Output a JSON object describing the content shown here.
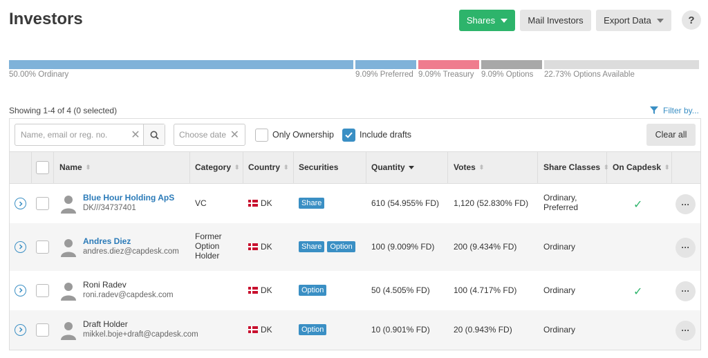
{
  "header": {
    "title": "Investors",
    "shares_btn": "Shares",
    "mail_btn": "Mail Investors",
    "export_btn": "Export Data",
    "help": "?"
  },
  "distribution": [
    {
      "label": "50.00% Ordinary",
      "share": 0.5,
      "color": "#7fb2d9"
    },
    {
      "label": "9.09% Preferred",
      "share": 0.0909,
      "color": "#7fb2d9"
    },
    {
      "label": "9.09% Treasury",
      "share": 0.0909,
      "color": "#ef7c8e"
    },
    {
      "label": "9.09% Options",
      "share": 0.0909,
      "color": "#a8a8a8"
    },
    {
      "label": "22.73% Options Available",
      "share": 0.2273,
      "color": "#dcdcdc"
    }
  ],
  "showing": "Showing 1-4 of 4 (0 selected)",
  "filter_by": "Filter by...",
  "filters": {
    "search_placeholder": "Name, email or reg. no.",
    "date_placeholder": "Choose date",
    "only_ownership": "Only Ownership",
    "include_drafts": "Include drafts",
    "clear_all": "Clear all"
  },
  "columns": {
    "name": "Name",
    "category": "Category",
    "country": "Country",
    "securities": "Securities",
    "quantity": "Quantity",
    "votes": "Votes",
    "share_classes": "Share Classes",
    "on_capdesk": "On Capdesk"
  },
  "rows": [
    {
      "name": "Blue Hour Holding ApS",
      "sub": "DK///34737401",
      "category": "VC",
      "country": "DK",
      "securities": [
        "Share"
      ],
      "quantity": "610 (54.955% FD)",
      "votes": "1,120 (52.830% FD)",
      "classes": "Ordinary, Preferred",
      "on_capdesk": true,
      "link": true
    },
    {
      "name": "Andres Diez",
      "sub": "andres.diez@capdesk.com",
      "category": "Former Option Holder",
      "country": "DK",
      "securities": [
        "Share",
        "Option"
      ],
      "quantity": "100 (9.009% FD)",
      "votes": "200 (9.434% FD)",
      "classes": "Ordinary",
      "on_capdesk": false,
      "link": true
    },
    {
      "name": "Roni Radev",
      "sub": "roni.radev@capdesk.com",
      "category": "",
      "country": "DK",
      "securities": [
        "Option"
      ],
      "quantity": "50 (4.505% FD)",
      "votes": "100 (4.717% FD)",
      "classes": "Ordinary",
      "on_capdesk": true,
      "link": false
    },
    {
      "name": "Draft Holder",
      "sub": "mikkel.boje+draft@capdesk.com",
      "category": "",
      "country": "DK",
      "securities": [
        "Option"
      ],
      "quantity": "10 (0.901% FD)",
      "votes": "20 (0.943% FD)",
      "classes": "Ordinary",
      "on_capdesk": false,
      "link": false
    }
  ]
}
